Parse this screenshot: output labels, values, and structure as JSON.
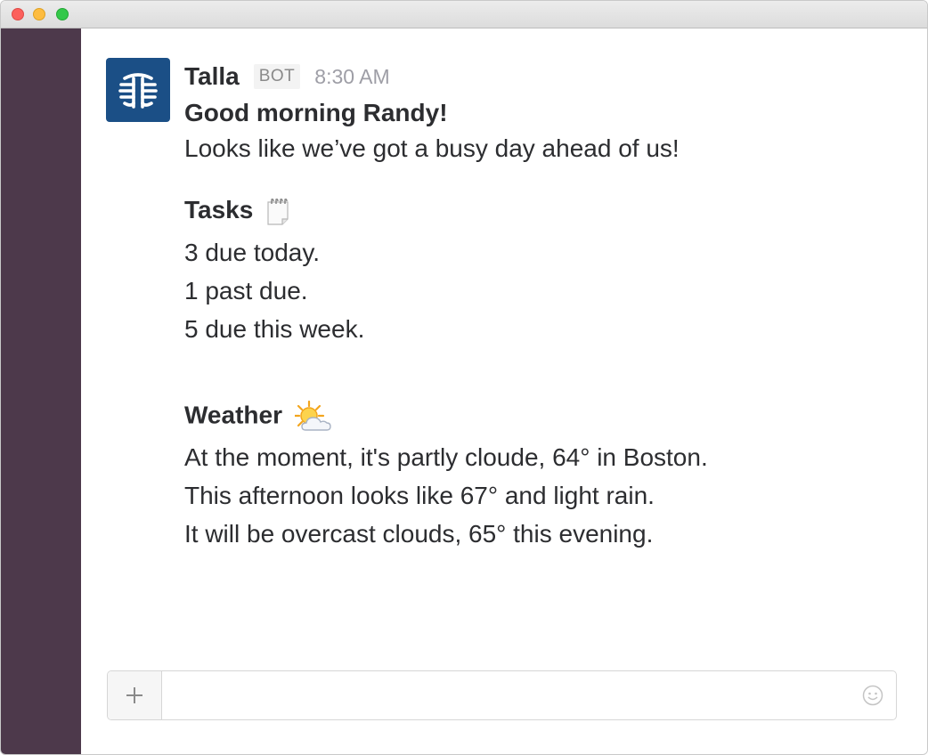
{
  "sender": {
    "name": "Talla",
    "badge": "BOT",
    "time": "8:30 AM"
  },
  "message": {
    "greeting": "Good morning Randy!",
    "intro": "Looks like we’ve got a busy day ahead of us!",
    "tasks": {
      "heading": "Tasks",
      "icon": "notepad-icon",
      "lines": [
        "3 due today.",
        "1 past due.",
        "5 due this week."
      ]
    },
    "weather": {
      "heading": "Weather",
      "icon": "sun-behind-cloud-icon",
      "lines": [
        "At the moment, it's partly cloude, 64° in Boston.",
        "This afternoon looks like 67° and light rain.",
        "It will be overcast clouds, 65° this evening."
      ]
    }
  },
  "composer": {
    "value": "",
    "placeholder": "",
    "add_icon": "plus-icon",
    "emoji_icon": "smiley-icon"
  },
  "colors": {
    "sidebar": "#4d394b",
    "avatar": "#1b4f86",
    "text": "#2c2d30",
    "timestamp": "#9e9ea6"
  }
}
